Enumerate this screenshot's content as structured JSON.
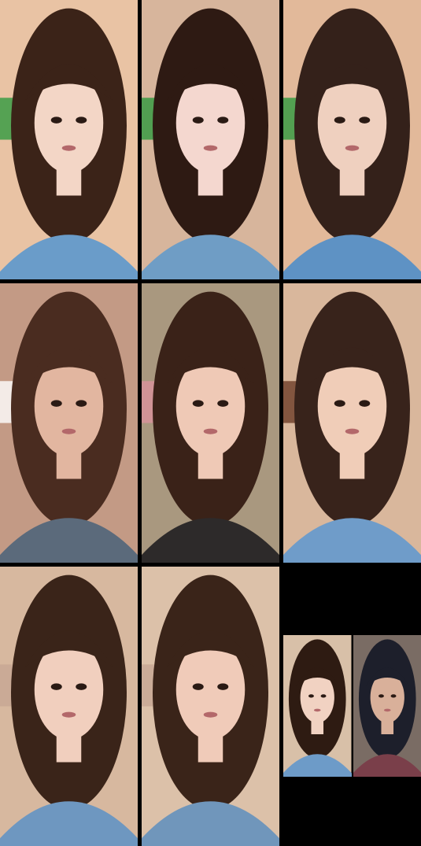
{
  "grid": {
    "tiles": [
      {
        "bg": "#e9c3a4",
        "hair": "#3b2318",
        "skin": "#f3d6c6",
        "shirt": "#6a9cc9",
        "accent": "#2f9a3e"
      },
      {
        "bg": "#d7b59c",
        "hair": "#2e1a13",
        "skin": "#f4d7cf",
        "shirt": "#6f9dc5",
        "accent": "#2f9a3e"
      },
      {
        "bg": "#e2b99a",
        "hair": "#34211a",
        "skin": "#efd0bf",
        "shirt": "#5e92c4",
        "accent": "#2f9a3e"
      },
      {
        "bg": "#c39a85",
        "hair": "#4a2c20",
        "skin": "#e2b6a0",
        "shirt": "#5b6a7b",
        "accent": "#ffffff"
      },
      {
        "bg": "#a9987f",
        "hair": "#3a2218",
        "skin": "#efc9b6",
        "shirt": "#2d2a2a",
        "accent": "#d9929c"
      },
      {
        "bg": "#d9b79c",
        "hair": "#38231b",
        "skin": "#f0cdb8",
        "shirt": "#6f9cc9",
        "accent": "#6b3c28"
      },
      {
        "bg": "#d7b89f",
        "hair": "#3a2419",
        "skin": "#f1cfbe",
        "shirt": "#6e97c0",
        "accent": "#c7a693"
      },
      {
        "bg": "#dcc1a9",
        "hair": "#3a2419",
        "skin": "#f0cbb9",
        "shirt": "#7096bb",
        "accent": "#c7a693"
      }
    ],
    "pip": {
      "left": {
        "bg": "#d8c0a8",
        "hair": "#2e1b12",
        "skin": "#f1d2c2",
        "shirt": "#6d9bc8"
      },
      "right": {
        "bg": "#7a6c64",
        "hair": "#1d1f2b",
        "skin": "#d9b09a",
        "shirt": "#7a3f4a"
      }
    }
  }
}
